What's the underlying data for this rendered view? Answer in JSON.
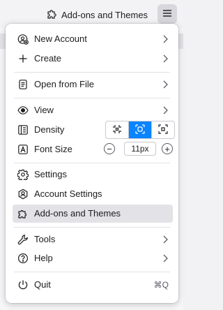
{
  "header": {
    "title": "Add-ons and Themes",
    "title_icon": "puzzle-icon",
    "menu_icon": "hamburger-icon"
  },
  "menu": {
    "new_account": {
      "label": "New Account",
      "icon": "account-plus-icon",
      "has_submenu": true
    },
    "create": {
      "label": "Create",
      "icon": "plus-icon",
      "has_submenu": true
    },
    "open_from_file": {
      "label": "Open from File",
      "icon": "file-icon",
      "has_submenu": true
    },
    "view": {
      "label": "View",
      "icon": "eye-icon",
      "has_submenu": true
    },
    "density": {
      "label": "Density",
      "icon": "density-icon",
      "options": [
        "compact",
        "normal",
        "touch"
      ],
      "selected": "normal"
    },
    "font_size": {
      "label": "Font Size",
      "icon": "font-icon",
      "value": "11px"
    },
    "settings": {
      "label": "Settings",
      "icon": "gear-icon"
    },
    "account_settings": {
      "label": "Account Settings",
      "icon": "account-settings-icon"
    },
    "addons": {
      "label": "Add-ons and Themes",
      "icon": "puzzle-icon",
      "highlighted": true
    },
    "tools": {
      "label": "Tools",
      "icon": "wrench-icon",
      "has_submenu": true
    },
    "help": {
      "label": "Help",
      "icon": "help-icon",
      "has_submenu": true
    },
    "quit": {
      "label": "Quit",
      "icon": "power-icon",
      "shortcut": "⌘Q"
    }
  },
  "colors": {
    "accent": "#0a84ff",
    "highlight": "#e3e3e7",
    "text": "#1c1c1e"
  }
}
